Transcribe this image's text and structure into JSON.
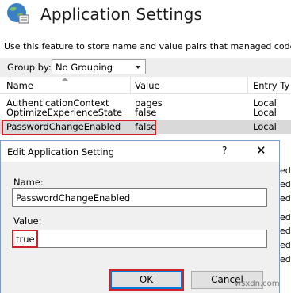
{
  "header": {
    "title": "Application Settings",
    "description": "Use this feature to store name and value pairs that managed code app"
  },
  "toolbar": {
    "group_by_label": "Group by:",
    "group_by_value": "No Grouping"
  },
  "grid": {
    "columns": [
      "Name",
      "Value",
      "Entry Ty"
    ],
    "rows": [
      {
        "name": "AuthenticationContext",
        "value": "pages",
        "entry_type": "Local"
      },
      {
        "name": "OptimizeExperienceState",
        "value": "false",
        "entry_type": "Local"
      },
      {
        "name": "PasswordChangeEnabled",
        "value": "false",
        "entry_type": "Local",
        "selected": true
      }
    ],
    "obscured_entry_fragments": [
      "ed",
      "ed",
      "ed",
      "ed",
      "ed",
      "ed",
      "ed"
    ]
  },
  "dialog": {
    "title": "Edit Application Setting",
    "help_glyph": "?",
    "close_glyph": "✕",
    "name_label": "Name:",
    "name_value": "PasswordChangeEnabled",
    "value_label": "Value:",
    "value_value": "true",
    "ok_label": "OK",
    "cancel_label": "Cancel"
  },
  "watermark": "wsxdn.com",
  "colors": {
    "highlight": "#d0202a",
    "selected_row": "#d9d9d9",
    "focus_border": "#0078d7"
  }
}
